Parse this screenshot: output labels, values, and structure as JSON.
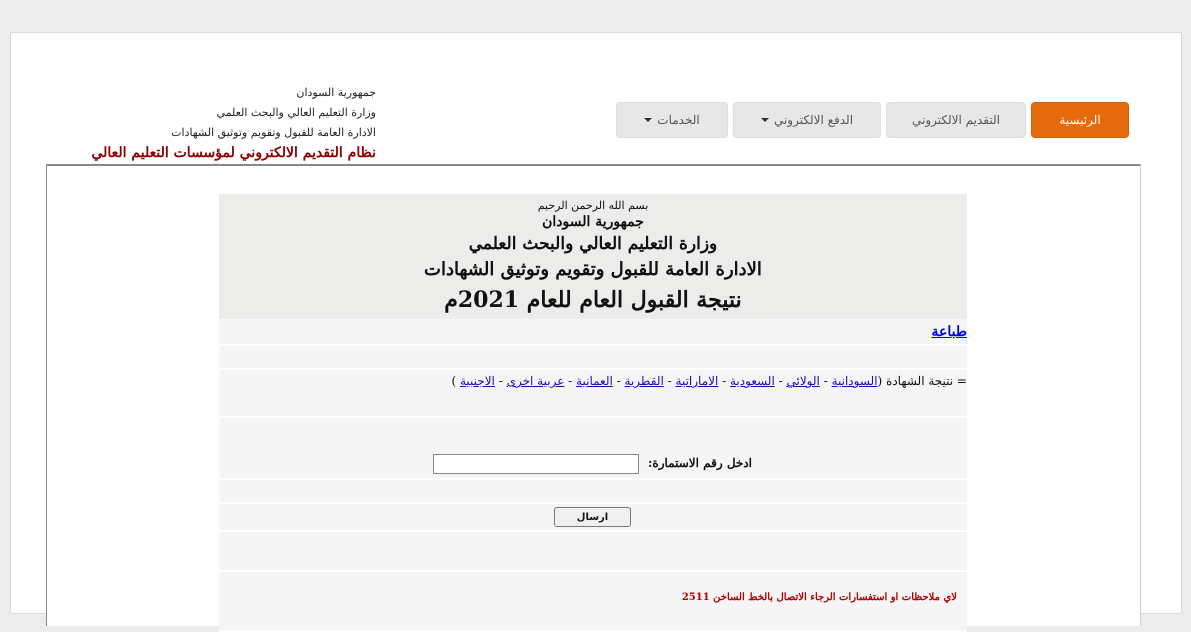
{
  "brand": {
    "line1": "جمهورية السودان",
    "line2": "وزارة التعليم العالي والبحث العلمي",
    "line3": "الادارة العامة للقبول وتقويم وتوثيق الشهادات",
    "system": "نظام التقديم الالكتروني لمؤسسات التعليم العالي"
  },
  "nav": {
    "home": "الرئيسية",
    "apply": "التقديم الالكتروني",
    "payment": "الدفع الالكتروني",
    "services": "الخدمات"
  },
  "header": {
    "basmala": "بسم الله الرحمن الرحيم",
    "republic": "جمهورية السودان",
    "ministry": "وزارة التعليم العالي والبحث العلمي",
    "directorate": "الادارة العامة للقبول وتقويم وتوثيق الشهادات",
    "result_title": "نتيجة القبول العام  للعام 2021م"
  },
  "print_link": "طباعة",
  "certificates": {
    "prefix": "= نتيجة الشهادة (",
    "sudanese": "السودانية",
    "state": "الولائي",
    "saudi": "السعودية",
    "emirati": "الاماراتية",
    "qatari": "القطرية",
    "omani": "العمانية",
    "other_arab": "عربية اخرى",
    "foreign": "الاجنبية",
    "sep": " - ",
    "suffix": " )"
  },
  "form": {
    "label": "ادخل  رقم الاستمارة:",
    "submit": "ارسال"
  },
  "contact": "لاي ملاحظات او استفسارات الرجاء الاتصال بالخط الساخن 2511",
  "colors": {
    "accent": "#e56a0c",
    "system_title": "#8b0000",
    "contact_text": "#b00000"
  }
}
